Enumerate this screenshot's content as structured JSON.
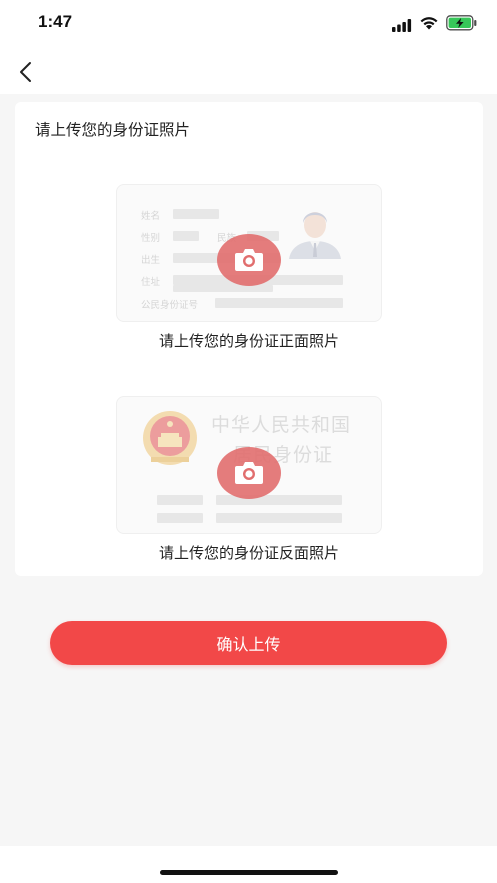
{
  "status_bar": {
    "time": "1:47"
  },
  "nav": {
    "back_icon": "chevron-left-icon"
  },
  "card": {
    "title": "请上传您的身份证照片",
    "front": {
      "caption": "请上传您的身份证正面照片",
      "fields": [
        "姓名",
        "性别",
        "民族",
        "出生",
        "住址",
        "公民身份证号"
      ]
    },
    "back": {
      "caption": "请上传您的身份证反面照片",
      "line1": "中华人民共和国",
      "line2": "居民身份证"
    }
  },
  "confirm_button": {
    "label": "确认上传",
    "color": "#f24848"
  },
  "colors": {
    "accent": "#f24848",
    "camera_bg": "#e16e6e",
    "page_bg": "#f6f6f6"
  }
}
